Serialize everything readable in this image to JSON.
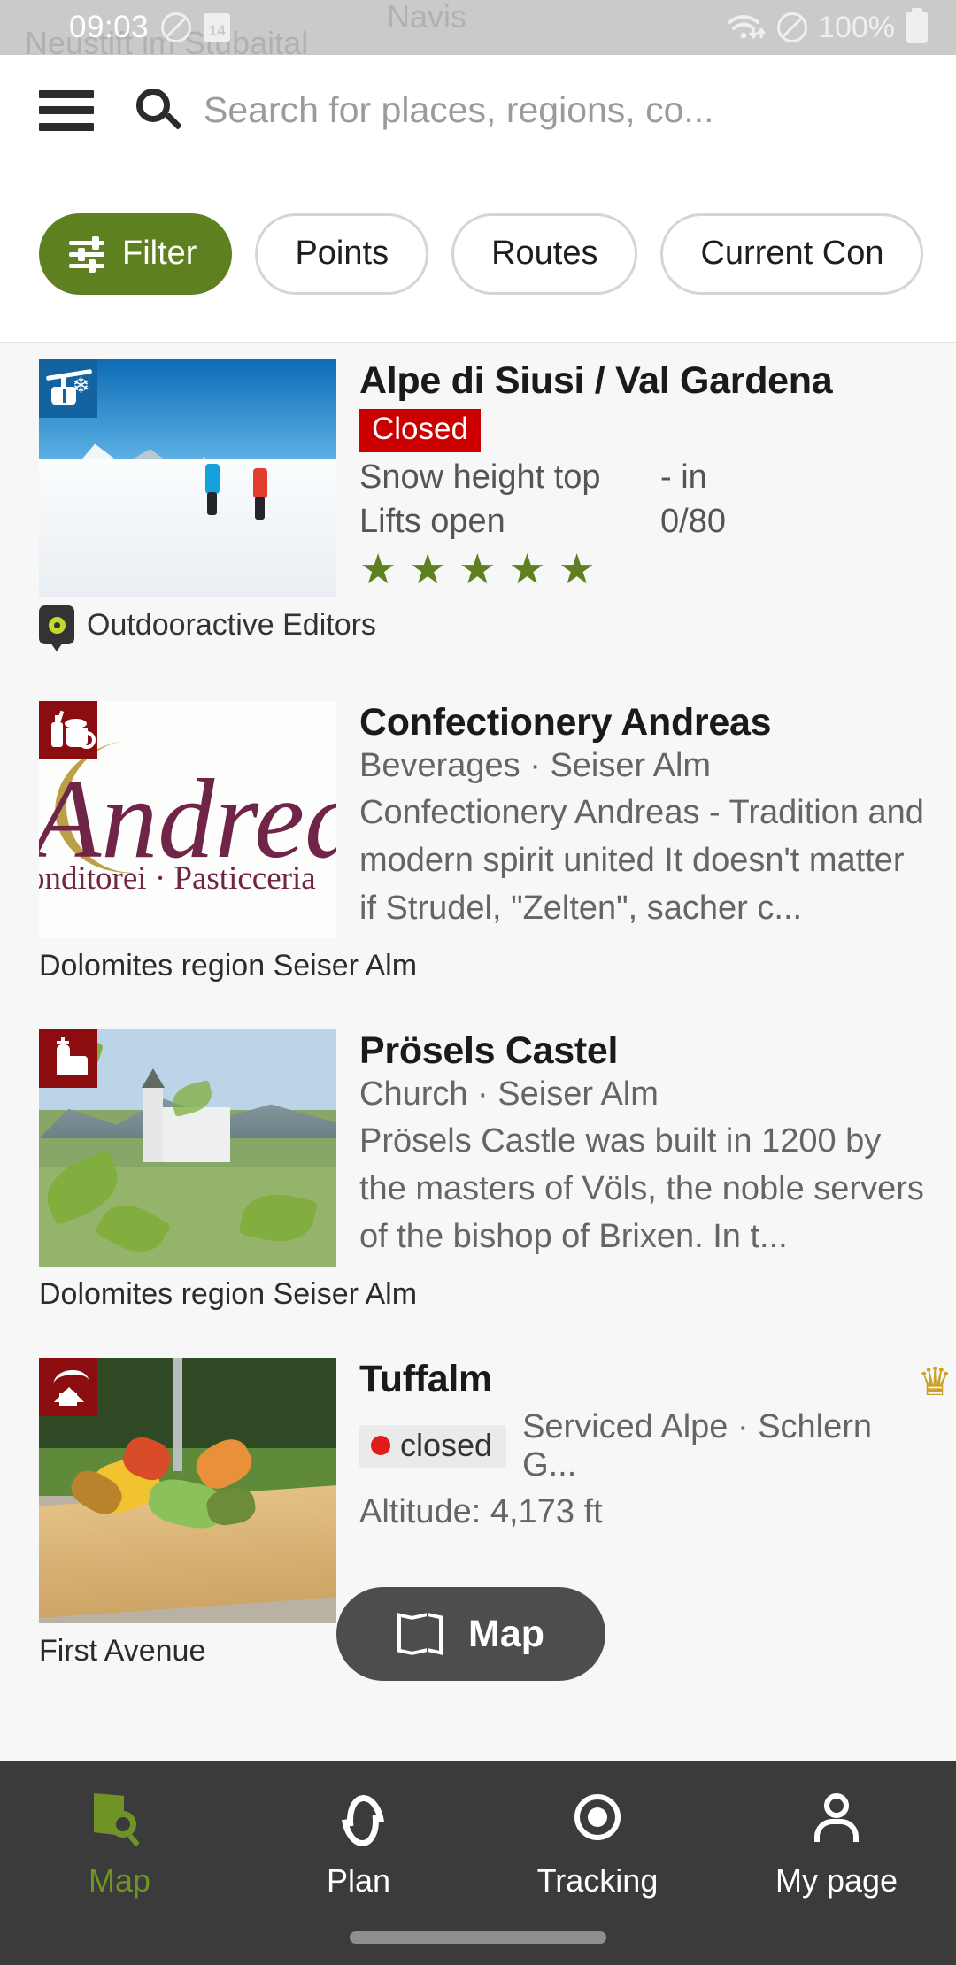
{
  "status_bar": {
    "time": "09:03",
    "battery_percent": "100%",
    "calendar_day": "14",
    "map_ghost_labels": [
      "Neustift im Stubaital",
      "Navis"
    ],
    "icons": [
      "dnd-icon",
      "calendar-icon",
      "wifi-icon",
      "battery-icon"
    ]
  },
  "header": {
    "menu_icon": "hamburger-menu-icon",
    "search_icon": "search-icon",
    "search_placeholder": "Search for places, regions, co...",
    "search_value": ""
  },
  "chips": [
    {
      "label": "Filter",
      "active": true,
      "icon": "tune-filter-icon"
    },
    {
      "label": "Points",
      "active": false
    },
    {
      "label": "Routes",
      "active": false
    },
    {
      "label": "Current Con",
      "active": false
    }
  ],
  "results": [
    {
      "title": "Alpe di Siusi / Val Gardena",
      "status_badge": "Closed",
      "badge_icon": "ski-gondola-icon",
      "badge_color": "#1263a0",
      "stats": [
        {
          "key": "Snow height top",
          "value": "- in"
        },
        {
          "key": "Lifts open",
          "value": "0/80"
        }
      ],
      "rating_stars": 5,
      "rating_glyph": "★",
      "credit": "Outdooractive Editors",
      "credit_logo": "outdooractive-pin-icon",
      "photo": "ski-touring-photo"
    },
    {
      "title": "Confectionery Andreas",
      "subline": "Beverages · Seiser Alm",
      "description": "Confectionery Andreas - Tradition and modern spirit united It doesn't matter if Strudel, \"Zelten\", sacher c...",
      "badge_icon": "beverages-icon",
      "badge_color": "#8c0d10",
      "credit": "Dolomites region Seiser Alm",
      "photo": "andreas-logo-photo",
      "logo_script": "Andrea",
      "logo_sub": "onditorei · Pasticceria"
    },
    {
      "title": "Prösels Castel",
      "subline": "Church · Seiser Alm",
      "description": "Prösels Castle was built in 1200 by the masters of Völs, the noble servers of the bishop of Brixen. In t...",
      "badge_icon": "church-icon",
      "badge_color": "#8c0d10",
      "credit": "Dolomites region Seiser Alm",
      "photo": "proesels-castle-photo"
    },
    {
      "title": "Tuffalm",
      "open_state": "closed",
      "subline": "Serviced Alpe · Schlern G...",
      "altitude": "Altitude: 4,173 ft",
      "badge_icon": "alpine-hut-icon",
      "badge_color": "#8c0d10",
      "premium_icon": "crown-icon",
      "credit": "First Avenue",
      "photo": "alpine-food-platter-photo"
    }
  ],
  "map_fab": {
    "label": "Map",
    "icon": "map-fold-icon"
  },
  "bottom_nav": [
    {
      "label": "Map",
      "icon": "map-search-icon",
      "active": true
    },
    {
      "label": "Plan",
      "icon": "route-path-icon",
      "active": false
    },
    {
      "label": "Tracking",
      "icon": "target-record-icon",
      "active": false
    },
    {
      "label": "My page",
      "icon": "user-account-icon",
      "active": false
    }
  ],
  "colors": {
    "accent_green": "#5e8020",
    "nav_active_green": "#6f9324",
    "closed_red": "#cc0000",
    "category_red": "#8c0d10",
    "category_blue": "#1263a0",
    "crown_gold": "#c9a227",
    "fab_dark": "#4d4d4d",
    "nav_bg": "#3b3b3b"
  }
}
